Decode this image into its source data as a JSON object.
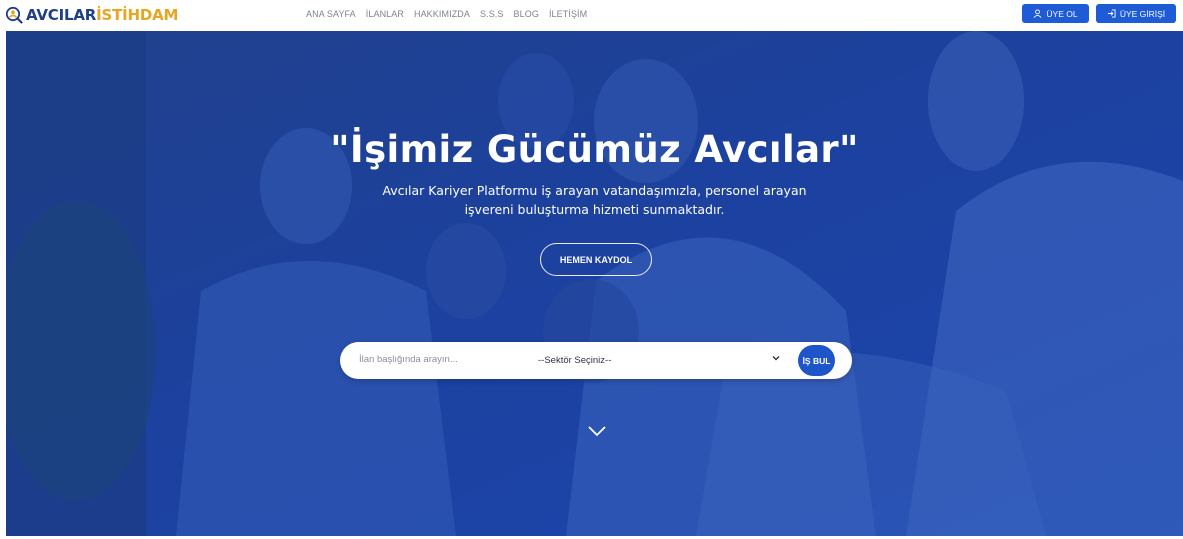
{
  "header": {
    "logo": {
      "part1": "AVCILAR",
      "part2": "İSTİHDAM"
    },
    "nav": [
      "ANA SAYFA",
      "İLANLAR",
      "HAKKIMIZDA",
      "S.S.S",
      "BLOG",
      "İLETİŞİM"
    ],
    "register_label": "ÜYE OL",
    "login_label": "ÜYE GİRİŞİ",
    "icons": {
      "logo": "magnifier-person-icon",
      "register": "user-icon",
      "login": "sign-in-icon"
    }
  },
  "hero": {
    "title": "\"İşimiz Gücümüz Avcılar\"",
    "subtitle_line1": "Avcılar Kariyer Platformu iş arayan vatandaşımızla, personel arayan",
    "subtitle_line2": "işvereni buluşturma hizmeti sunmaktadır.",
    "cta_label": "HEMEN KAYDOL",
    "search": {
      "placeholder": "İlan başlığında arayın...",
      "sector_selected": "--Sektör Seçiniz--",
      "find_label": "İŞ BUL"
    },
    "scroll_icon": "chevron-down-icon"
  },
  "colors": {
    "brand_blue": "#1f3f86",
    "brand_gold": "#e5a620",
    "button_blue": "#1e5bd6",
    "hero_blue": "#1d46a8"
  }
}
